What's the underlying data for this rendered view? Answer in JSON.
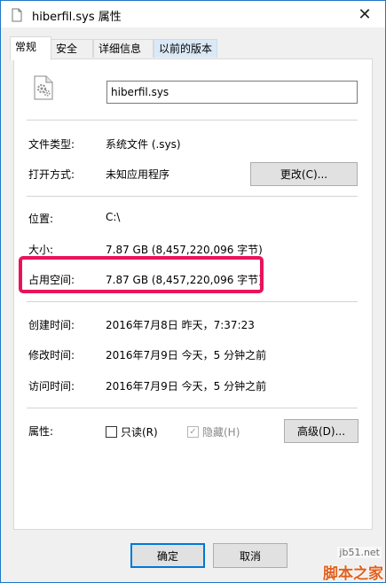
{
  "window": {
    "title": "hiberfil.sys 属性",
    "close_glyph": "✕"
  },
  "tabs": [
    {
      "label": "常规",
      "active": true
    },
    {
      "label": "安全",
      "active": false
    },
    {
      "label": "详细信息",
      "active": false
    },
    {
      "label": "以前的版本",
      "active": false
    }
  ],
  "general": {
    "filename": "hiberfil.sys",
    "type_label": "文件类型:",
    "type_value": "系统文件 (.sys)",
    "opens_label": "打开方式:",
    "opens_value": "未知应用程序",
    "change_button": "更改(C)...",
    "location_label": "位置:",
    "location_value": "C:\\",
    "size_label": "大小:",
    "size_value": "7.87 GB (8,457,220,096 字节)",
    "disk_label": "占用空间:",
    "disk_value": "7.87 GB (8,457,220,096 字节)",
    "created_label": "创建时间:",
    "created_value": "2016年7月8日 昨天，7:37:23",
    "modified_label": "修改时间:",
    "modified_value": "2016年7月9日 今天，5 分钟之前",
    "accessed_label": "访问时间:",
    "accessed_value": "2016年7月9日 今天，5 分钟之前",
    "attributes_label": "属性:",
    "readonly_label": "只读(R)",
    "readonly_checked": false,
    "hidden_label": "隐藏(H)",
    "hidden_checked": true,
    "advanced_button": "高级(D)..."
  },
  "footer": {
    "ok_button": "确定",
    "cancel_button": "取消"
  },
  "watermark": {
    "url": "jb51.net",
    "brand": "脚本之家"
  },
  "colors": {
    "highlight": "#e8145a",
    "accent": "#0078d7",
    "watermark": "#e0611d"
  }
}
